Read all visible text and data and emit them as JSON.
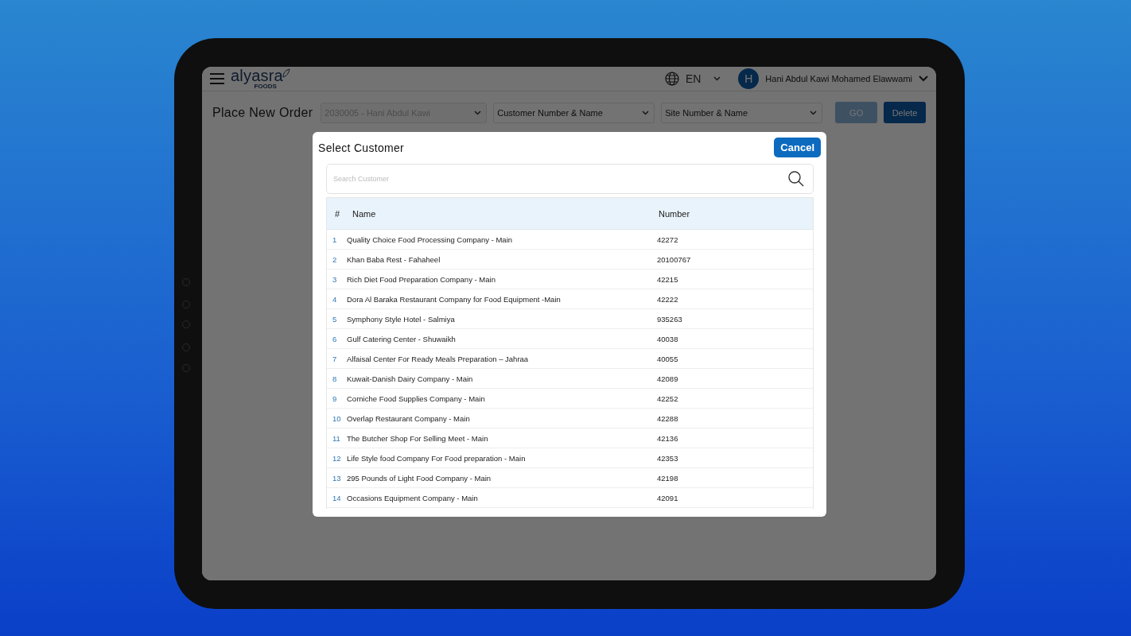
{
  "header": {
    "logo": {
      "name": "alyasra",
      "tagline": "FOODS"
    },
    "language": "EN",
    "user": {
      "initial": "H",
      "name": "Hani Abdul Kawi Mohamed Elawwami"
    }
  },
  "toolbar": {
    "title": "Place New Order",
    "selects": [
      {
        "value": "2030005 - Hani Abdul Kawi",
        "disabled": true
      },
      {
        "value": "Customer Number & Name",
        "disabled": false
      },
      {
        "value": "Site Number & Name",
        "disabled": false
      }
    ],
    "buttons": [
      {
        "label": "GO",
        "disabled": true
      },
      {
        "label": "Delete",
        "disabled": false
      }
    ]
  },
  "dialog": {
    "title": "Select Customer",
    "cancel": "Cancel",
    "search": {
      "placeholder": "Search Customer"
    },
    "columns": [
      "#",
      "Name",
      "Number"
    ],
    "rows": [
      {
        "index": "1",
        "name": "Quality Choice Food Processing Company - Main",
        "number": "42272"
      },
      {
        "index": "2",
        "name": "Khan Baba Rest - Fahaheel",
        "number": "20100767"
      },
      {
        "index": "3",
        "name": "Rich Diet Food Preparation Company  - Main",
        "number": "42215"
      },
      {
        "index": "4",
        "name": "Dora Al Baraka Restaurant Company for Food Equipment -Main",
        "number": "42222"
      },
      {
        "index": "5",
        "name": "Symphony Style Hotel - Salmiya",
        "number": "935263"
      },
      {
        "index": "6",
        "name": "Gulf Catering Center - Shuwaikh",
        "number": "40038"
      },
      {
        "index": "7",
        "name": "Alfaisal Center For Ready Meals Preparation – Jahraa",
        "number": "40055"
      },
      {
        "index": "8",
        "name": "Kuwait-Danish Dairy Company - Main",
        "number": "42089"
      },
      {
        "index": "9",
        "name": "Corniche Food Supplies Company - Main",
        "number": "42252"
      },
      {
        "index": "10",
        "name": "Overlap Restaurant Company - Main",
        "number": "42288"
      },
      {
        "index": "11",
        "name": "The Butcher Shop For Selling Meet - Main",
        "number": "42136"
      },
      {
        "index": "12",
        "name": "Life Style food Company For Food preparation - Main",
        "number": "42353"
      },
      {
        "index": "13",
        "name": "295 Pounds of Light Food Company - Main",
        "number": "42198"
      },
      {
        "index": "14",
        "name": "Occasions Equipment Company - Main",
        "number": "42091"
      }
    ]
  }
}
